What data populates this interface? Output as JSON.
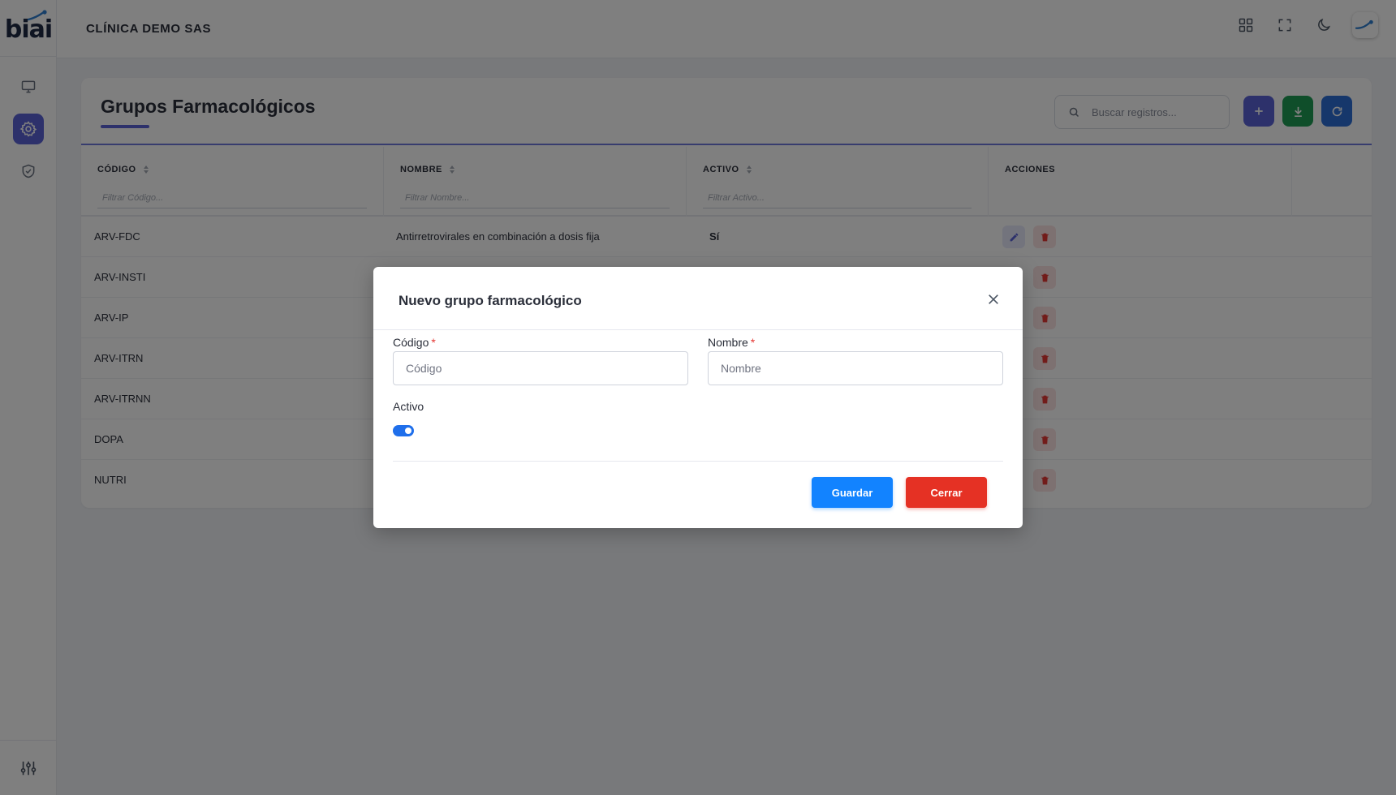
{
  "brand": {
    "logo_text": "biai",
    "accent": "#5b63d6",
    "company": "CLÍNICA DEMO SAS"
  },
  "sidebar": {
    "items": [
      {
        "icon": "monitor-icon",
        "active": false
      },
      {
        "icon": "gear-icon",
        "active": true
      },
      {
        "icon": "shield-check-icon",
        "active": false
      }
    ],
    "bottom_icon": "sliders-icon"
  },
  "topbar": {
    "icons": [
      "grid-icon",
      "fullscreen-icon",
      "moon-icon",
      "user-avatar"
    ]
  },
  "page": {
    "title": "Grupos Farmacológicos",
    "search_placeholder": "Buscar registros...",
    "buttons": [
      {
        "icon": "plus-icon",
        "color": "#5b63d6"
      },
      {
        "icon": "download-icon",
        "color": "#1f9d55"
      },
      {
        "icon": "refresh-icon",
        "color": "#2d6fd6"
      }
    ]
  },
  "table": {
    "columns": [
      {
        "label": "CÓDIGO",
        "filter_placeholder": "Filtrar Código...",
        "sortable": true
      },
      {
        "label": "NOMBRE",
        "filter_placeholder": "Filtrar Nombre...",
        "sortable": true
      },
      {
        "label": "ACTIVO",
        "filter_placeholder": "Filtrar Activo...",
        "sortable": true
      },
      {
        "label": "ACCIONES",
        "sortable": false
      }
    ],
    "rows": [
      {
        "codigo": "ARV-FDC",
        "nombre": "Antirretrovirales en combinación a dosis fija",
        "activo": "Sí"
      },
      {
        "codigo": "ARV-INSTI",
        "nombre": "",
        "activo": ""
      },
      {
        "codigo": "ARV-IP",
        "nombre": "",
        "activo": ""
      },
      {
        "codigo": "ARV-ITRN",
        "nombre": "",
        "activo": ""
      },
      {
        "codigo": "ARV-ITRNN",
        "nombre": "",
        "activo": ""
      },
      {
        "codigo": "DOPA",
        "nombre": "",
        "activo": ""
      },
      {
        "codigo": "NUTRI",
        "nombre": "",
        "activo": ""
      }
    ]
  },
  "modal": {
    "title": "Nuevo grupo farmacológico",
    "fields": {
      "codigo": {
        "label": "Código",
        "required_mark": "*",
        "placeholder": "Código",
        "value": ""
      },
      "nombre": {
        "label": "Nombre",
        "required_mark": "*",
        "placeholder": "Nombre",
        "value": ""
      },
      "activo": {
        "label": "Activo",
        "checked": true
      }
    },
    "buttons": {
      "save": "Guardar",
      "close": "Cerrar"
    },
    "colors": {
      "save": "#1283ff",
      "close": "#e53124",
      "toggle": "#1f6feb"
    }
  }
}
